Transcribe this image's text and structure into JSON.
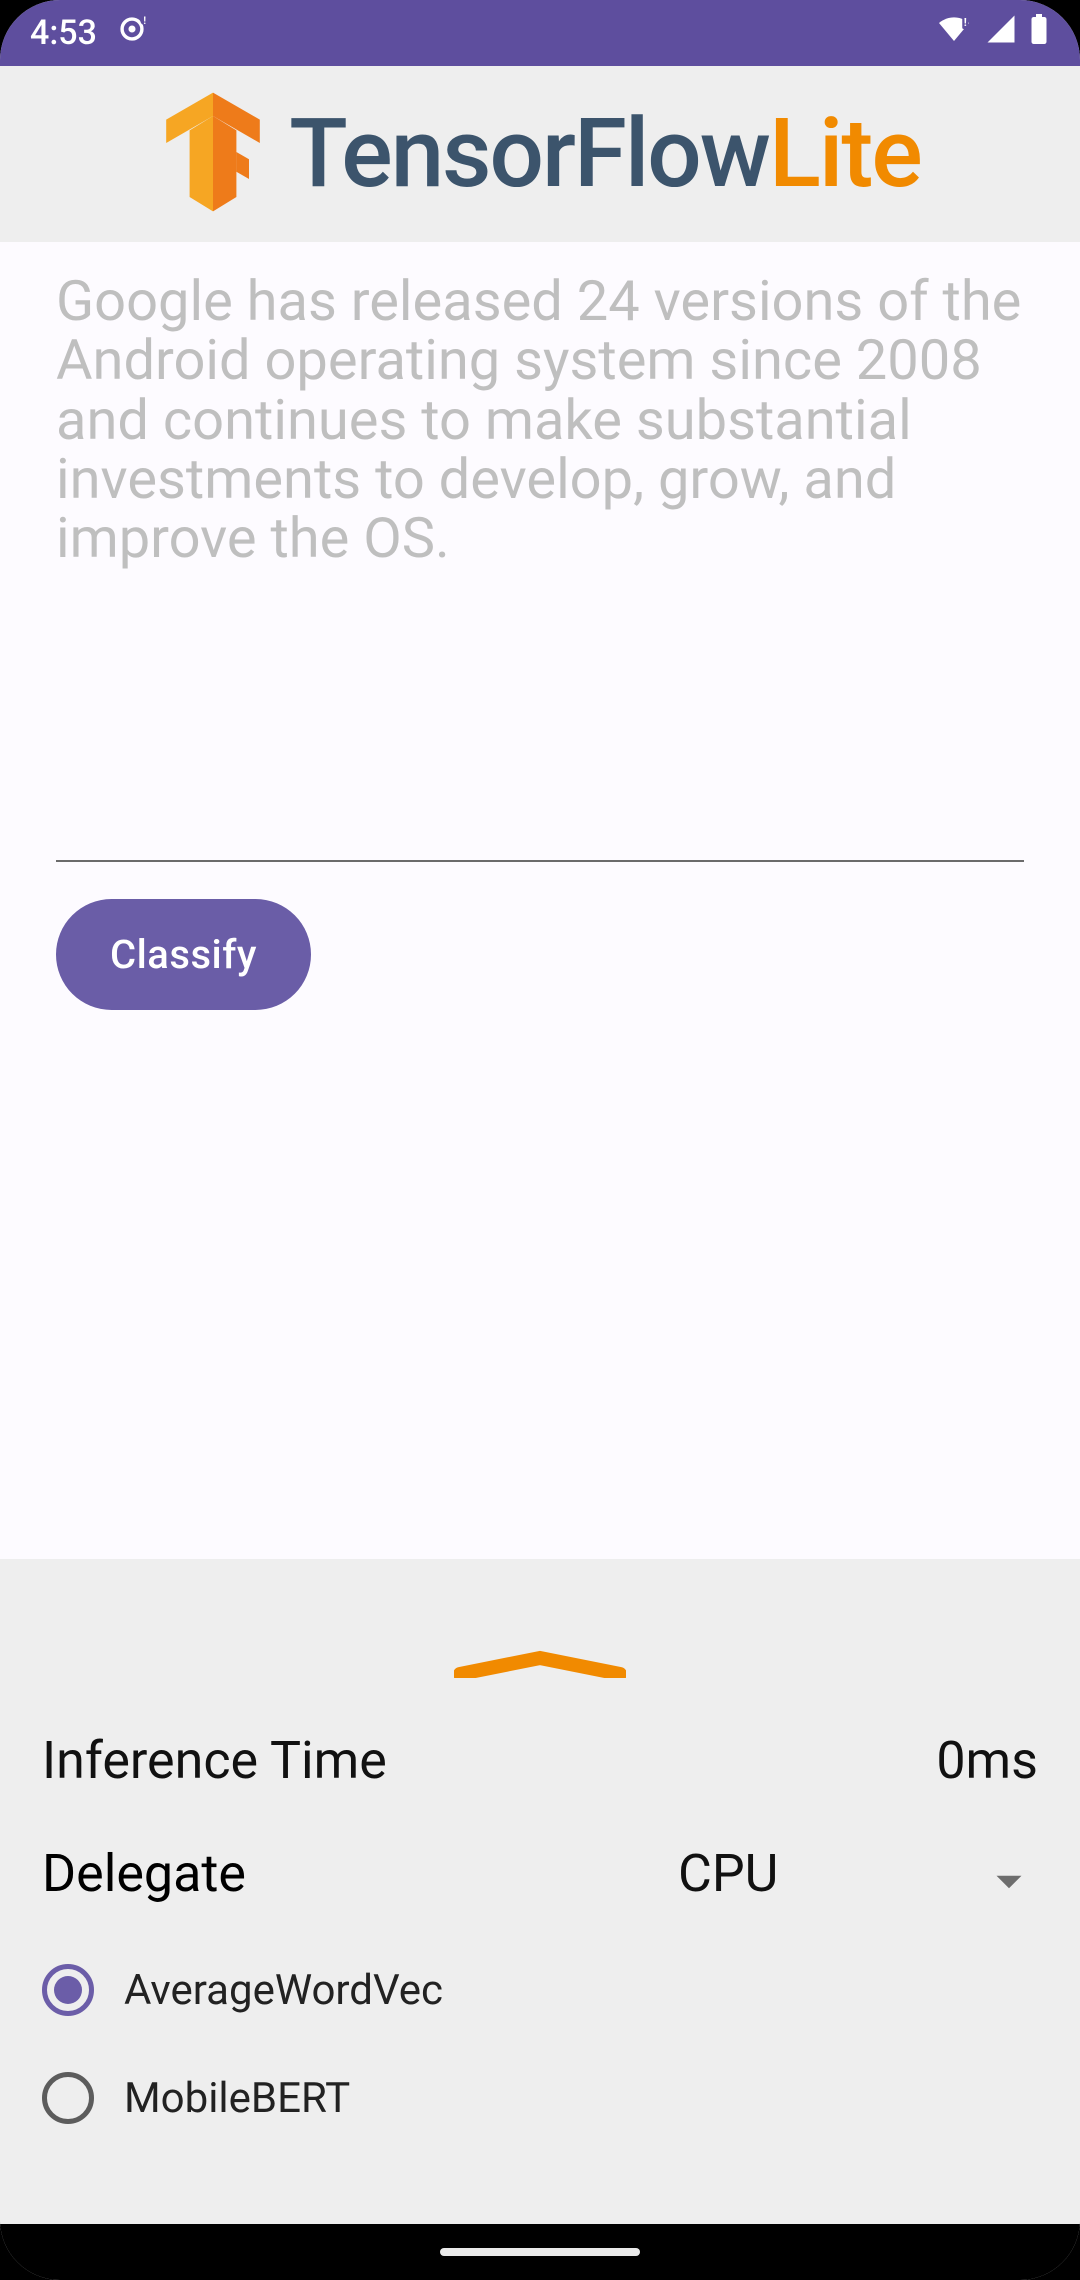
{
  "status_bar": {
    "time": "4:53",
    "location_icon": "location-icon"
  },
  "header": {
    "logo_tensorflow": "TensorFlow",
    "logo_lite": "Lite"
  },
  "main": {
    "input_placeholder": "Google has released 24 versions of the Android operating system since 2008 and continues to make substantial investments to develop, grow, and improve the OS.",
    "classify_label": "Classify"
  },
  "bottom_sheet": {
    "inference_time_label": "Inference Time",
    "inference_time_value": "0ms",
    "delegate_label": "Delegate",
    "delegate_value": "CPU",
    "radios": {
      "opt1_label": "AverageWordVec",
      "opt1_selected": true,
      "opt2_label": "MobileBERT",
      "opt2_selected": false
    }
  }
}
